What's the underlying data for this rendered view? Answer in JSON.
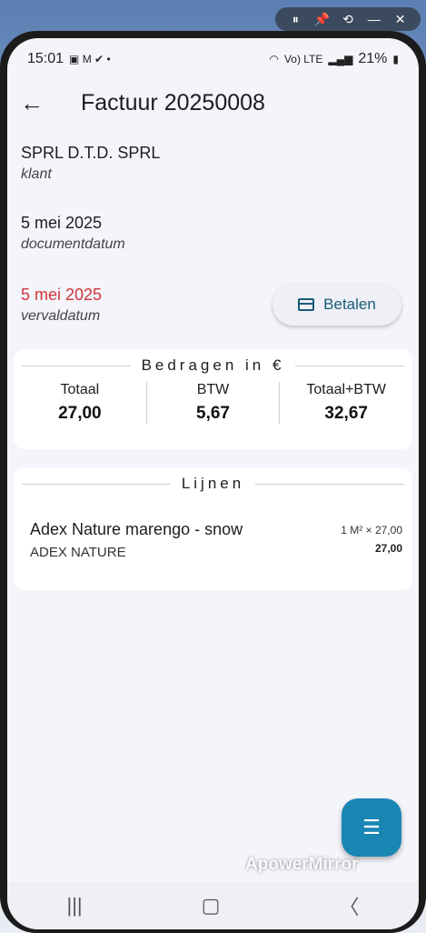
{
  "mirror_toolbar": {
    "icons": [
      "pause-icon",
      "pin-icon",
      "rotate-icon",
      "minimize-icon",
      "close-icon"
    ],
    "glyphs": [
      "⏸",
      "📌",
      "⟲",
      "—",
      "✕"
    ]
  },
  "status_bar": {
    "time": "15:01",
    "network": "Vo) LTE",
    "battery": "21%"
  },
  "app_bar": {
    "title": "Factuur 20250008"
  },
  "fields": {
    "customer": {
      "value": "SPRL D.T.D. SPRL",
      "label": "klant"
    },
    "document_date": {
      "value": "5 mei 2025",
      "label": "documentdatum"
    },
    "due_date": {
      "value": "5 mei 2025",
      "label": "vervaldatum",
      "color": "#d0343b"
    }
  },
  "pay_button": {
    "label": "Betalen"
  },
  "amounts": {
    "section_title": "Bedragen in €",
    "columns": [
      {
        "header": "Totaal",
        "value": "27,00"
      },
      {
        "header": "BTW",
        "value": "5,67"
      },
      {
        "header": "Totaal+BTW",
        "value": "32,67"
      }
    ]
  },
  "lines": {
    "section_title": "Lijnen",
    "items": [
      {
        "name": "Adex Nature marengo - snow",
        "brand": "ADEX NATURE",
        "qty": "1 M² × 27,00",
        "total": "27,00"
      }
    ]
  },
  "watermark": "ApowerMirror",
  "colors": {
    "accent": "#1a86b4",
    "due": "#d0343b",
    "button_text": "#1a5a77"
  }
}
